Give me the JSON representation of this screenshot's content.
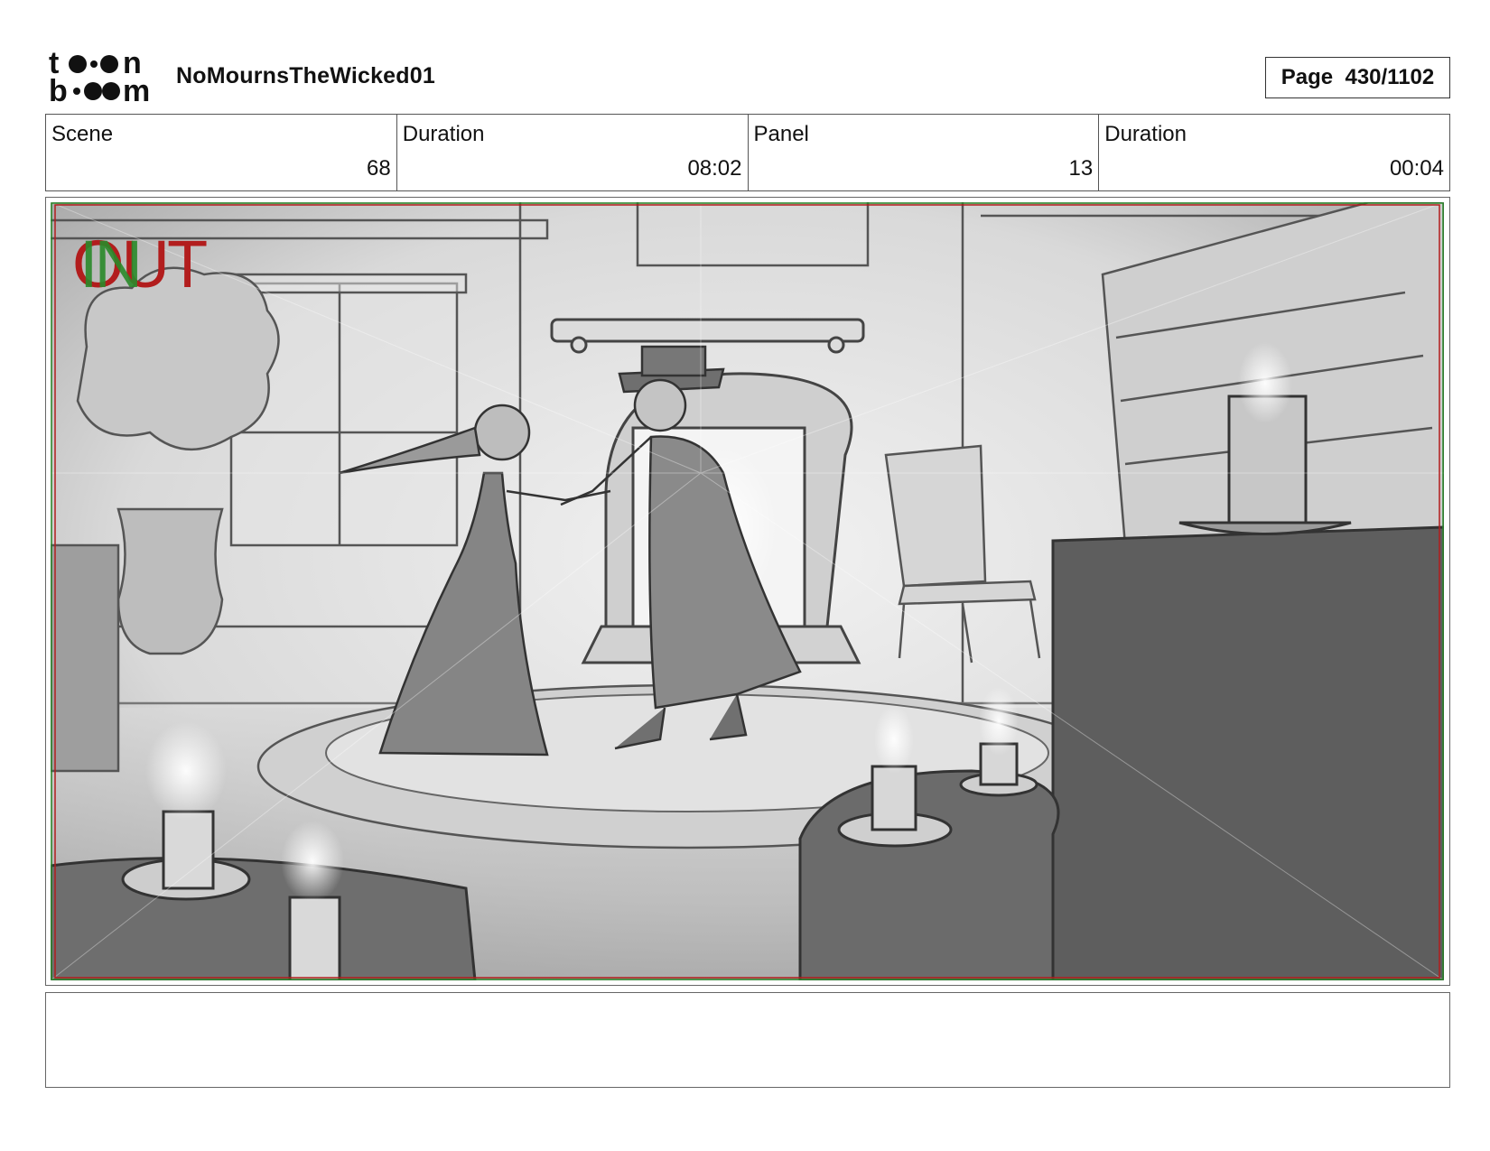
{
  "header": {
    "logo_text": "toon boom",
    "project_title": "NoMournsTheWicked01",
    "page_label": "Page",
    "page_value": "430/1102"
  },
  "info": [
    {
      "label": "Scene",
      "value": "68"
    },
    {
      "label": "Duration",
      "value": "08:02"
    },
    {
      "label": "Panel",
      "value": "13"
    },
    {
      "label": "Duration",
      "value": "00:04"
    }
  ],
  "panel": {
    "marker_out": "OUT",
    "marker_in": "IN",
    "safe_frame_colors": {
      "red": "#b21d1d",
      "green": "#2a8a2a"
    }
  },
  "notes": {
    "text": ""
  }
}
